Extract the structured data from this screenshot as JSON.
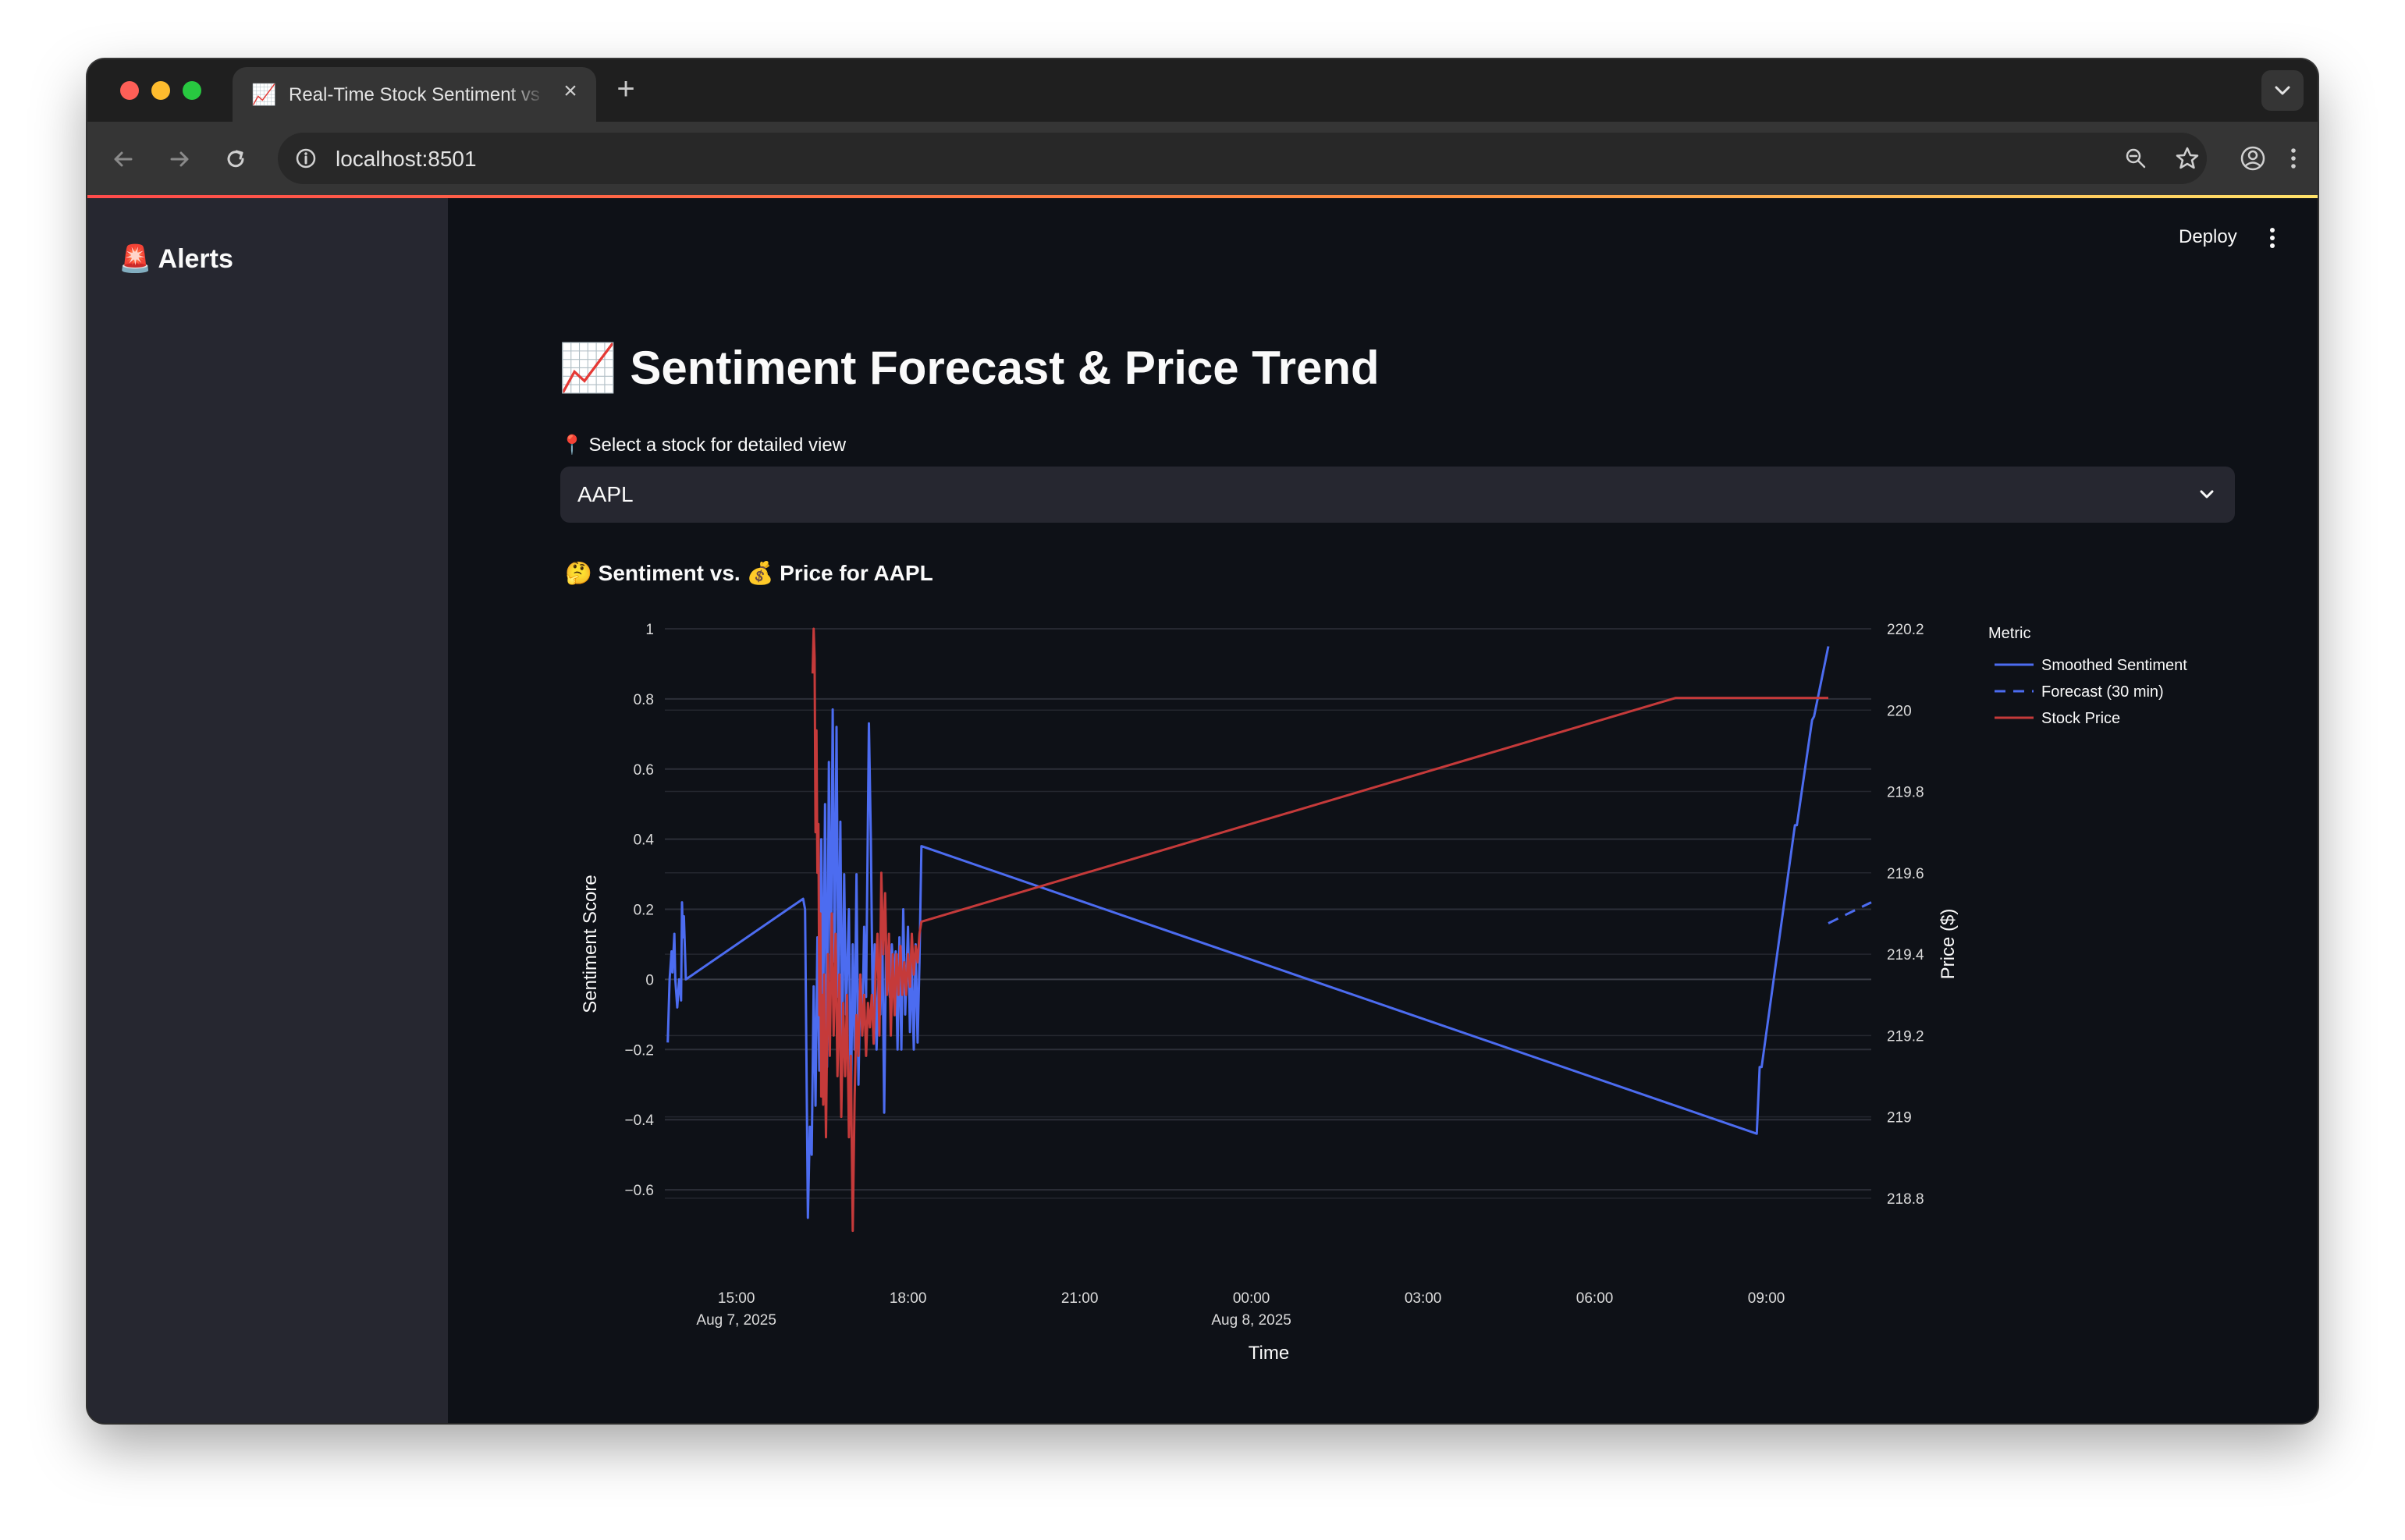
{
  "browser": {
    "tab_title": "Real-Time Stock Sentiment vs",
    "tab_favicon": "📈",
    "url": "localhost:8501"
  },
  "icons": {
    "back": "arrow-left-icon",
    "forward": "arrow-right-icon",
    "reload": "reload-icon",
    "info": "info-icon",
    "zoom": "zoom-icon",
    "bookmark": "star-icon",
    "profile": "profile-icon",
    "menu": "vertical-dots-icon"
  },
  "colors": {
    "background": "#0e1117",
    "sidebar": "#262730",
    "sentiment": "#4c6cf0",
    "price": "#c53a3a",
    "accent": "#ff4b4b"
  },
  "sidebar": {
    "title": "🚨 Alerts"
  },
  "header": {
    "deploy_label": "Deploy"
  },
  "main": {
    "title": "📈 Sentiment Forecast & Price Trend",
    "select_label": "📍 Select a stock for detailed view",
    "select_value": "AAPL",
    "chart_title": "🤔 Sentiment vs. 💰 Price for AAPL"
  },
  "chart_data": {
    "type": "line",
    "xlabel": "Time",
    "ylabel": "Sentiment Score",
    "y2label": "Price ($)",
    "x_range": [
      "2025-08-07T13:45",
      "2025-08-08T10:50"
    ],
    "ylim": [
      -0.74,
      1.0
    ],
    "y2lim": [
      218.7,
      220.2
    ],
    "x_ticks": [
      {
        "t": "2025-08-07T15:00",
        "line1": "15:00",
        "line2": "Aug 7, 2025"
      },
      {
        "t": "2025-08-07T18:00",
        "line1": "18:00",
        "line2": ""
      },
      {
        "t": "2025-08-07T21:00",
        "line1": "21:00",
        "line2": ""
      },
      {
        "t": "2025-08-08T00:00",
        "line1": "00:00",
        "line2": "Aug 8, 2025"
      },
      {
        "t": "2025-08-08T03:00",
        "line1": "03:00",
        "line2": ""
      },
      {
        "t": "2025-08-08T06:00",
        "line1": "06:00",
        "line2": ""
      },
      {
        "t": "2025-08-08T09:00",
        "line1": "09:00",
        "line2": ""
      }
    ],
    "y_ticks": [
      "1",
      "0.8",
      "0.6",
      "0.4",
      "0.2",
      "0",
      "−0.2",
      "−0.4",
      "−0.6"
    ],
    "y_tick_values": [
      1,
      0.8,
      0.6,
      0.4,
      0.2,
      0,
      -0.2,
      -0.4,
      -0.6
    ],
    "y2_ticks": [
      "220.2",
      "220",
      "219.8",
      "219.6",
      "219.4",
      "219.2",
      "219",
      "218.8"
    ],
    "y2_tick_values": [
      220.2,
      220,
      219.8,
      219.6,
      219.4,
      219.2,
      219,
      218.8
    ],
    "grid": true,
    "legend": {
      "title": "Metric",
      "position": "right"
    },
    "series": [
      {
        "name": "Smoothed Sentiment",
        "color": "#4c6cf0",
        "dash": "solid",
        "axis": "y",
        "points": [
          [
            "2025-08-07T13:48",
            -0.18
          ],
          [
            "2025-08-07T13:50",
            0.0
          ],
          [
            "2025-08-07T13:52",
            0.08
          ],
          [
            "2025-08-07T13:53",
            0.02
          ],
          [
            "2025-08-07T13:55",
            0.13
          ],
          [
            "2025-08-07T13:56",
            0.0
          ],
          [
            "2025-08-07T13:58",
            -0.08
          ],
          [
            "2025-08-07T14:00",
            0.0
          ],
          [
            "2025-08-07T14:02",
            -0.06
          ],
          [
            "2025-08-07T14:03",
            0.22
          ],
          [
            "2025-08-07T14:04",
            0.12
          ],
          [
            "2025-08-07T14:05",
            0.18
          ],
          [
            "2025-08-07T14:07",
            0.0
          ],
          [
            "2025-08-07T16:10",
            0.23
          ],
          [
            "2025-08-07T16:12",
            0.2
          ],
          [
            "2025-08-07T16:15",
            -0.68
          ],
          [
            "2025-08-07T16:17",
            -0.42
          ],
          [
            "2025-08-07T16:19",
            -0.5
          ],
          [
            "2025-08-07T16:21",
            -0.02
          ],
          [
            "2025-08-07T16:23",
            -0.36
          ],
          [
            "2025-08-07T16:25",
            0.12
          ],
          [
            "2025-08-07T16:27",
            -0.26
          ],
          [
            "2025-08-07T16:29",
            0.4
          ],
          [
            "2025-08-07T16:31",
            -0.1
          ],
          [
            "2025-08-07T16:33",
            0.5
          ],
          [
            "2025-08-07T16:35",
            -0.25
          ],
          [
            "2025-08-07T16:37",
            0.62
          ],
          [
            "2025-08-07T16:39",
            0.0
          ],
          [
            "2025-08-07T16:41",
            0.77
          ],
          [
            "2025-08-07T16:43",
            0.05
          ],
          [
            "2025-08-07T16:45",
            0.72
          ],
          [
            "2025-08-07T16:47",
            -0.05
          ],
          [
            "2025-08-07T16:49",
            0.45
          ],
          [
            "2025-08-07T16:51",
            -0.2
          ],
          [
            "2025-08-07T16:53",
            0.3
          ],
          [
            "2025-08-07T16:55",
            -0.1
          ],
          [
            "2025-08-07T16:58",
            0.2
          ],
          [
            "2025-08-07T17:00",
            -0.4
          ],
          [
            "2025-08-07T17:02",
            0.1
          ],
          [
            "2025-08-07T17:04",
            -0.2
          ],
          [
            "2025-08-07T17:06",
            0.3
          ],
          [
            "2025-08-07T17:08",
            -0.3
          ],
          [
            "2025-08-07T17:10",
            0.0
          ],
          [
            "2025-08-07T17:12",
            -0.15
          ],
          [
            "2025-08-07T17:14",
            0.15
          ],
          [
            "2025-08-07T17:16",
            -0.05
          ],
          [
            "2025-08-07T17:19",
            0.73
          ],
          [
            "2025-08-07T17:21",
            0.4
          ],
          [
            "2025-08-07T17:23",
            -0.1
          ],
          [
            "2025-08-07T17:25",
            0.1
          ],
          [
            "2025-08-07T17:27",
            -0.2
          ],
          [
            "2025-08-07T17:29",
            0.0
          ],
          [
            "2025-08-07T17:31",
            -0.1
          ],
          [
            "2025-08-07T17:33",
            0.15
          ],
          [
            "2025-08-07T17:35",
            -0.38
          ],
          [
            "2025-08-07T17:37",
            0.1
          ],
          [
            "2025-08-07T17:39",
            0.05
          ],
          [
            "2025-08-07T17:41",
            -0.05
          ],
          [
            "2025-08-07T17:43",
            0.1
          ],
          [
            "2025-08-07T17:45",
            0.0
          ],
          [
            "2025-08-07T17:47",
            0.08
          ],
          [
            "2025-08-07T17:49",
            -0.2
          ],
          [
            "2025-08-07T17:51",
            0.12
          ],
          [
            "2025-08-07T17:53",
            -0.2
          ],
          [
            "2025-08-07T17:55",
            0.2
          ],
          [
            "2025-08-07T17:57",
            -0.1
          ],
          [
            "2025-08-07T18:00",
            0.15
          ],
          [
            "2025-08-07T18:02",
            -0.15
          ],
          [
            "2025-08-07T18:04",
            0.05
          ],
          [
            "2025-08-07T18:06",
            -0.2
          ],
          [
            "2025-08-07T18:08",
            0.1
          ],
          [
            "2025-08-07T18:10",
            -0.18
          ],
          [
            "2025-08-07T18:12",
            0.05
          ],
          [
            "2025-08-07T18:14",
            0.38
          ],
          [
            "2025-08-08T08:50",
            -0.44
          ],
          [
            "2025-08-08T08:53",
            -0.25
          ],
          [
            "2025-08-08T08:55",
            -0.25
          ],
          [
            "2025-08-08T09:30",
            0.44
          ],
          [
            "2025-08-08T09:32",
            0.44
          ],
          [
            "2025-08-08T09:48",
            0.74
          ],
          [
            "2025-08-08T09:50",
            0.75
          ],
          [
            "2025-08-08T10:05",
            0.95
          ]
        ]
      },
      {
        "name": "Forecast (30 min)",
        "color": "#4c6cf0",
        "dash": "dashed",
        "axis": "y",
        "points": [
          [
            "2025-08-08T10:05",
            0.16
          ],
          [
            "2025-08-08T10:20",
            0.18
          ],
          [
            "2025-08-08T10:35",
            0.2
          ],
          [
            "2025-08-08T10:50",
            0.22
          ]
        ]
      },
      {
        "name": "Stock Price",
        "color": "#c53a3a",
        "dash": "solid",
        "axis": "y2",
        "points": [
          [
            "2025-08-07T16:20",
            220.09
          ],
          [
            "2025-08-07T16:21",
            220.2
          ],
          [
            "2025-08-07T16:22",
            220.13
          ],
          [
            "2025-08-07T16:23",
            219.7
          ],
          [
            "2025-08-07T16:24",
            219.95
          ],
          [
            "2025-08-07T16:25",
            219.6
          ],
          [
            "2025-08-07T16:26",
            219.72
          ],
          [
            "2025-08-07T16:27",
            219.25
          ],
          [
            "2025-08-07T16:28",
            219.5
          ],
          [
            "2025-08-07T16:29",
            219.05
          ],
          [
            "2025-08-07T16:30",
            219.3
          ],
          [
            "2025-08-07T16:31",
            219.03
          ],
          [
            "2025-08-07T16:32",
            219.35
          ],
          [
            "2025-08-07T16:34",
            218.95
          ],
          [
            "2025-08-07T16:36",
            219.4
          ],
          [
            "2025-08-07T16:38",
            219.15
          ],
          [
            "2025-08-07T16:40",
            219.5
          ],
          [
            "2025-08-07T16:42",
            219.2
          ],
          [
            "2025-08-07T16:44",
            219.45
          ],
          [
            "2025-08-07T16:46",
            219.1
          ],
          [
            "2025-08-07T16:48",
            219.35
          ],
          [
            "2025-08-07T16:50",
            219.0
          ],
          [
            "2025-08-07T16:52",
            219.28
          ],
          [
            "2025-08-07T16:54",
            219.1
          ],
          [
            "2025-08-07T16:56",
            219.3
          ],
          [
            "2025-08-07T16:58",
            218.95
          ],
          [
            "2025-08-07T17:00",
            219.15
          ],
          [
            "2025-08-07T17:02",
            218.72
          ],
          [
            "2025-08-07T17:04",
            219.05
          ],
          [
            "2025-08-07T17:06",
            219.25
          ],
          [
            "2025-08-07T17:08",
            219.15
          ],
          [
            "2025-08-07T17:10",
            219.35
          ],
          [
            "2025-08-07T17:12",
            219.2
          ],
          [
            "2025-08-07T17:14",
            219.3
          ],
          [
            "2025-08-07T17:16",
            219.15
          ],
          [
            "2025-08-07T17:18",
            219.28
          ],
          [
            "2025-08-07T17:20",
            219.22
          ],
          [
            "2025-08-07T17:22",
            219.3
          ],
          [
            "2025-08-07T17:24",
            219.18
          ],
          [
            "2025-08-07T17:26",
            219.35
          ],
          [
            "2025-08-07T17:28",
            219.45
          ],
          [
            "2025-08-07T17:30",
            219.2
          ],
          [
            "2025-08-07T17:32",
            219.6
          ],
          [
            "2025-08-07T17:34",
            219.4
          ],
          [
            "2025-08-07T17:36",
            219.55
          ],
          [
            "2025-08-07T17:38",
            219.3
          ],
          [
            "2025-08-07T17:40",
            219.45
          ],
          [
            "2025-08-07T17:42",
            219.2
          ],
          [
            "2025-08-07T17:44",
            219.4
          ],
          [
            "2025-08-07T17:46",
            219.25
          ],
          [
            "2025-08-07T17:48",
            219.4
          ],
          [
            "2025-08-07T17:50",
            219.3
          ],
          [
            "2025-08-07T17:52",
            219.42
          ],
          [
            "2025-08-07T17:54",
            219.3
          ],
          [
            "2025-08-07T17:56",
            219.38
          ],
          [
            "2025-08-07T17:58",
            219.3
          ],
          [
            "2025-08-07T18:00",
            219.4
          ],
          [
            "2025-08-07T18:02",
            219.32
          ],
          [
            "2025-08-07T18:04",
            219.45
          ],
          [
            "2025-08-07T18:06",
            219.35
          ],
          [
            "2025-08-07T18:08",
            219.42
          ],
          [
            "2025-08-07T18:10",
            219.38
          ],
          [
            "2025-08-07T18:12",
            219.45
          ],
          [
            "2025-08-07T18:14",
            219.48
          ],
          [
            "2025-08-08T07:25",
            220.03
          ],
          [
            "2025-08-08T10:05",
            220.03
          ]
        ]
      }
    ]
  }
}
